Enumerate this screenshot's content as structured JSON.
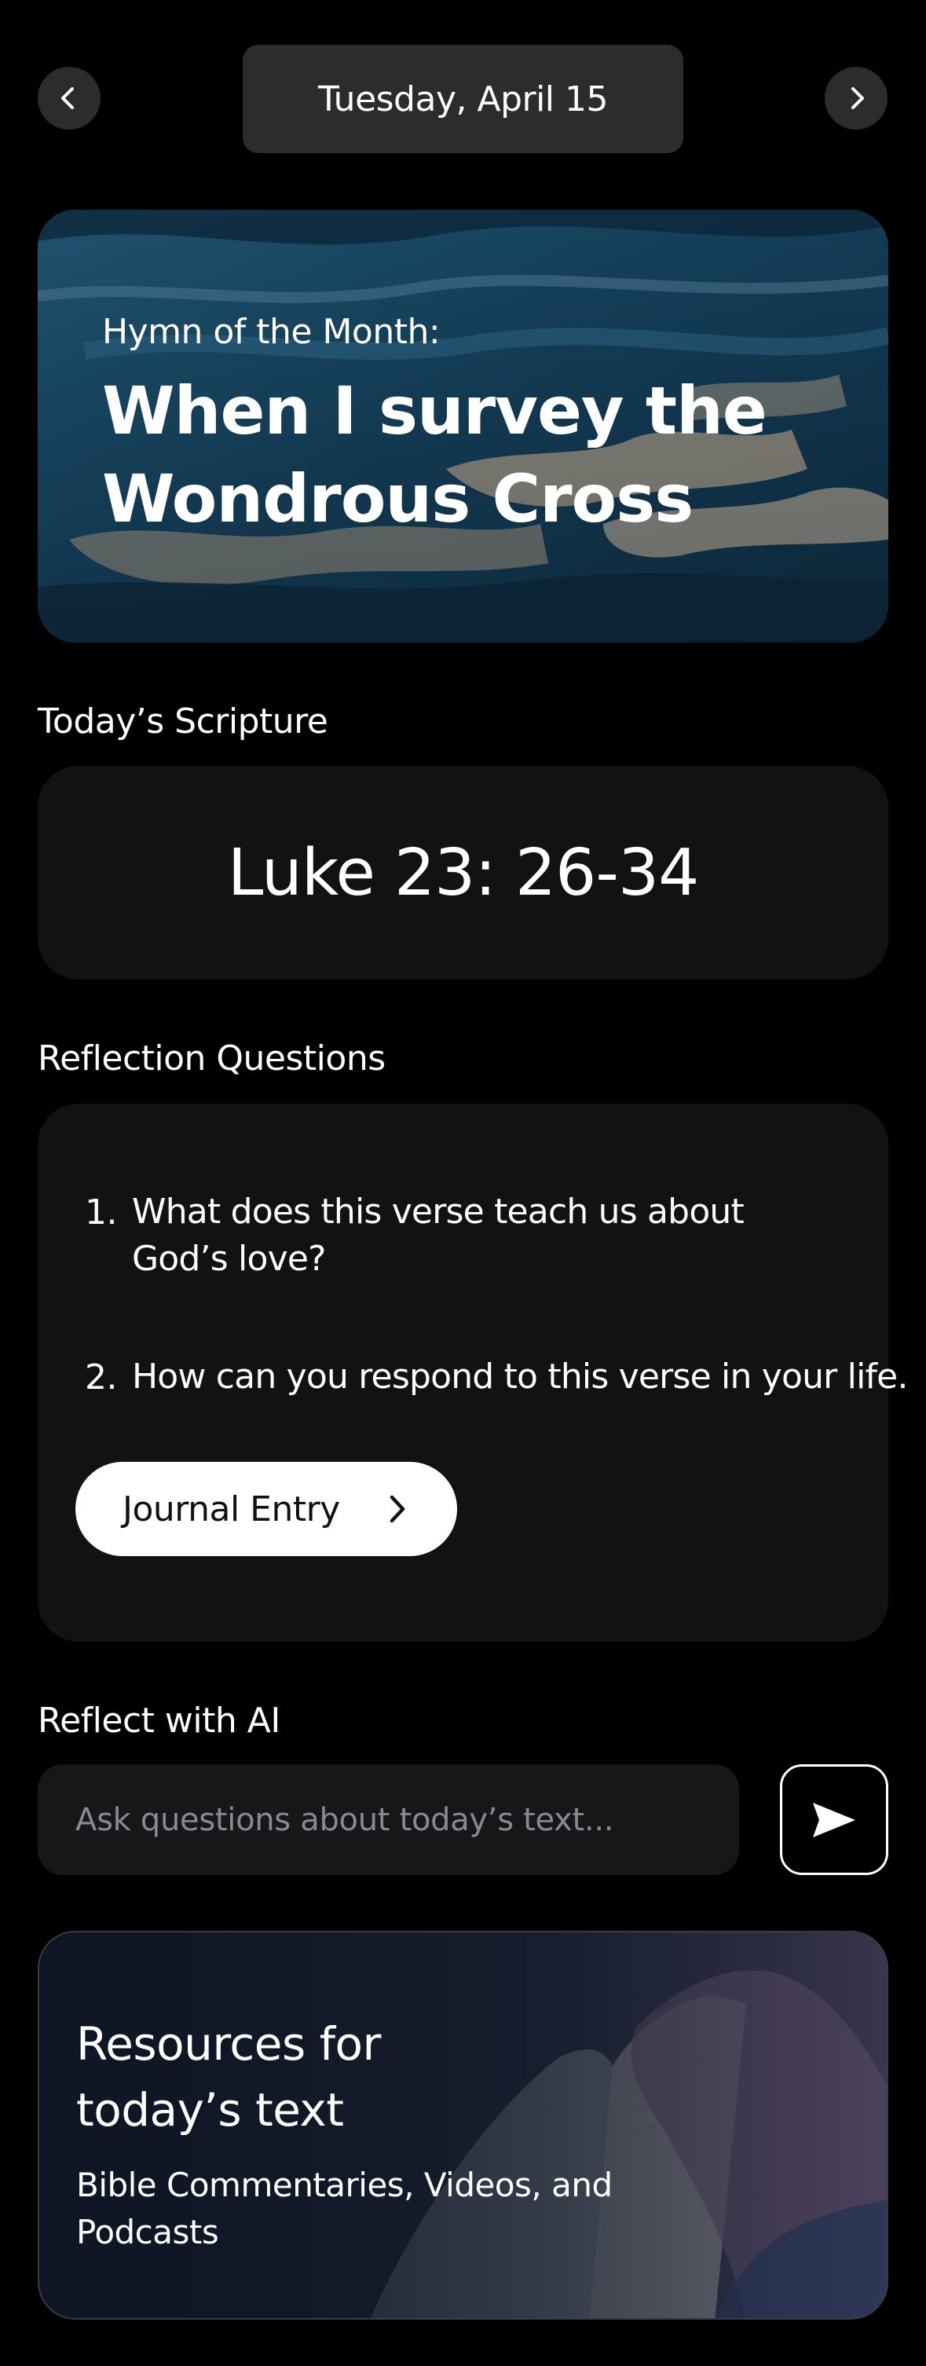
{
  "header": {
    "date_label": "Tuesday, April 15",
    "prev_icon": "chevron-left-icon",
    "next_icon": "chevron-right-icon"
  },
  "hymn": {
    "eyebrow": "Hymn of the Month:",
    "title": "When I survey the Wondrous Cross"
  },
  "scripture": {
    "section_label": "Today’s Scripture",
    "reference": "Luke 23: 26-34"
  },
  "reflection": {
    "section_label": "Reflection Questions",
    "questions": [
      {
        "number": "1.",
        "text": "What does this verse teach us about God’s love?"
      },
      {
        "number": "2.",
        "text": "How can you respond to this verse in your life."
      }
    ],
    "journal_button": "Journal Entry",
    "journal_icon": "chevron-right-icon"
  },
  "ai": {
    "section_label": "Reflect with AI",
    "placeholder": "Ask questions about today’s text...",
    "send_icon": "send-icon"
  },
  "resources": {
    "title": "Resources for today’s text",
    "subtitle": "Bible Commentaries, Videos, and Podcasts"
  },
  "colors": {
    "background": "#000000",
    "surface": "#111213",
    "pill": "#2c2c2e",
    "placeholder": "#8a8a8e",
    "accent_white": "#ffffff"
  }
}
